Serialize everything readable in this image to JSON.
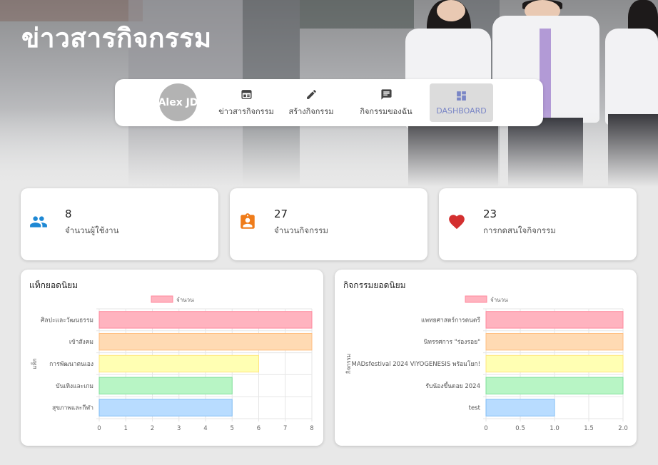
{
  "page": {
    "title": "ข่าวสารกิจกรรม"
  },
  "nav": {
    "avatar": "Alex JD",
    "items": [
      {
        "label": "ข่าวสารกิจกรรม",
        "icon": "newspaper-icon",
        "active": false
      },
      {
        "label": "สร้างกิจกรรม",
        "icon": "pencil-icon",
        "active": false
      },
      {
        "label": "กิจกรรมของฉัน",
        "icon": "message-icon",
        "active": false
      },
      {
        "label": "DASHBOARD",
        "icon": "dashboard-icon",
        "active": true
      }
    ]
  },
  "stats": [
    {
      "value": "8",
      "label": "จำนวนผู้ใช้งาน",
      "icon": "users-icon",
      "color": "#1e88d4"
    },
    {
      "value": "27",
      "label": "จำนวนกิจกรรม",
      "icon": "badge-icon",
      "color": "#ef7c1a"
    },
    {
      "value": "23",
      "label": "การกดสนใจกิจกรรม",
      "icon": "heart-icon",
      "color": "#d32f2f"
    }
  ],
  "chart_data": [
    {
      "type": "bar",
      "orientation": "horizontal",
      "title": "แท็กยอดนิยม",
      "ylabel": "แท็ก",
      "xlabel": "",
      "categories": [
        "ศิลปะและวัฒนธรรม",
        "เข้าสังคม",
        "การพัฒนาตนเอง",
        "บันเทิงและเกม",
        "สุขภาพและกีฬา"
      ],
      "series": [
        {
          "name": "จำนวน",
          "values": [
            8,
            8,
            6,
            5,
            5
          ]
        }
      ],
      "xlim": [
        0,
        8
      ],
      "xticks": [
        "0",
        "1",
        "2",
        "3",
        "4",
        "5",
        "6",
        "7",
        "8"
      ],
      "grid": true,
      "legend": "top",
      "colors": [
        "#ffb3bf",
        "#ffdab3",
        "#ffffb3",
        "#b8f5c5",
        "#b8dcff"
      ],
      "borders": [
        "#ff8a9e",
        "#ffbf80",
        "#ffe680",
        "#80e09a",
        "#80bdf5"
      ]
    },
    {
      "type": "bar",
      "orientation": "horizontal",
      "title": "กิจกรรมยอดนิยม",
      "ylabel": "กิจกรรม",
      "xlabel": "",
      "categories": [
        "แพทยศาสตร์การดนตรี",
        "นิทรรศการ \"ร่องรอย\"",
        "MADsfestival 2024 VIYOGENESIS พร้อมโยก!",
        "รับน้องขึ้นดอย 2024",
        "test"
      ],
      "series": [
        {
          "name": "จำนวน",
          "values": [
            2,
            2,
            2,
            2,
            1
          ]
        }
      ],
      "xlim": [
        0,
        2
      ],
      "xticks": [
        "0",
        "0.5",
        "1.0",
        "1.5",
        "2.0"
      ],
      "grid": true,
      "legend": "top",
      "colors": [
        "#ffb3bf",
        "#ffdab3",
        "#ffffb3",
        "#b8f5c5",
        "#b8dcff"
      ],
      "borders": [
        "#ff8a9e",
        "#ffbf80",
        "#ffe680",
        "#80e09a",
        "#80bdf5"
      ]
    }
  ]
}
